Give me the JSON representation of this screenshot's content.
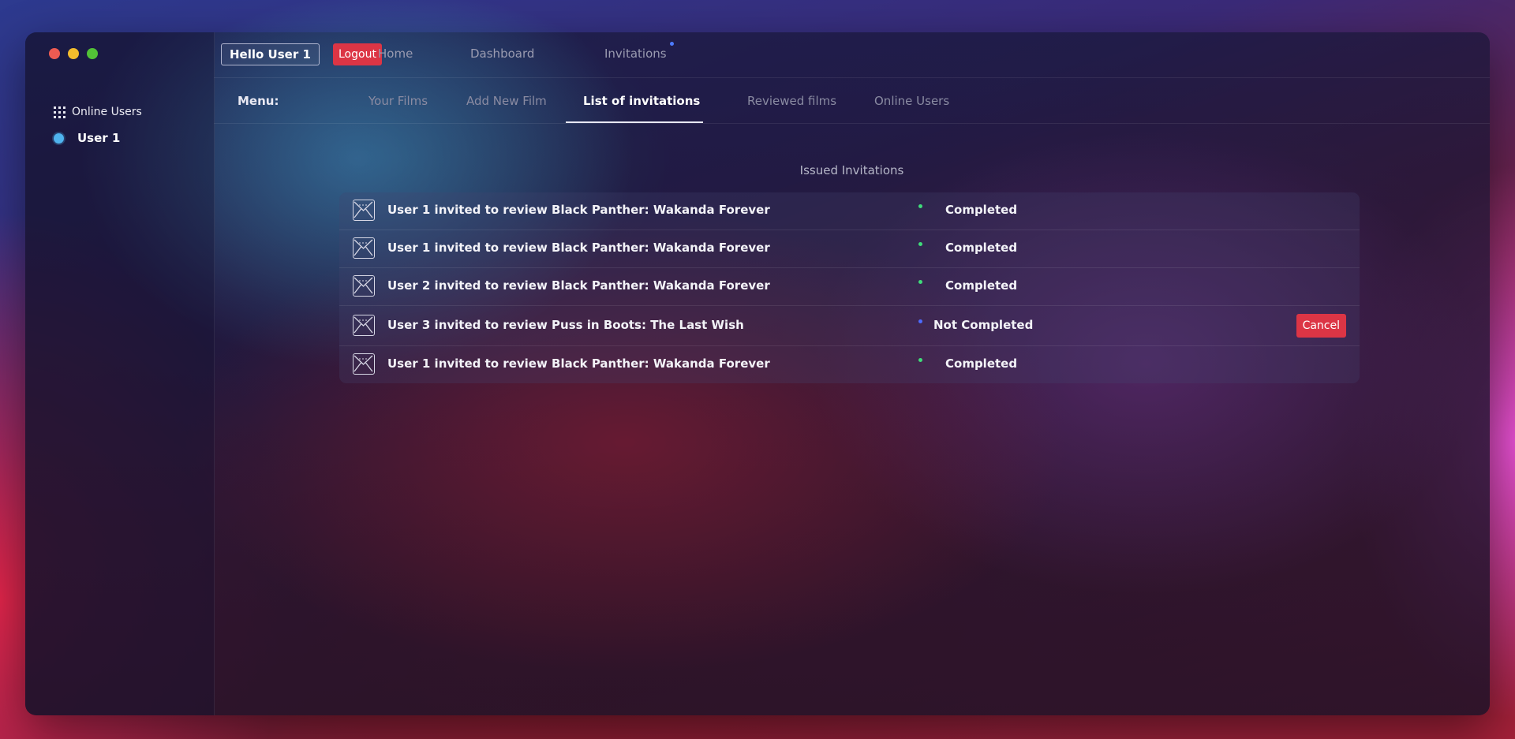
{
  "header": {
    "hello_label": "Hello User 1",
    "logout_label": "Logout",
    "nav": [
      {
        "label": "Home"
      },
      {
        "label": "Dashboard"
      },
      {
        "label": "Invitations"
      }
    ]
  },
  "sidebar": {
    "heading": "Online Users",
    "users": [
      {
        "name": "User 1"
      }
    ]
  },
  "menu": {
    "label": "Menu:",
    "tabs": [
      {
        "label": "Your Films"
      },
      {
        "label": "Add New Film"
      },
      {
        "label": "List of invitations",
        "active": true
      },
      {
        "label": "Reviewed films"
      },
      {
        "label": "Online Users"
      }
    ]
  },
  "main": {
    "section_title": "Issued Invitations",
    "invitations": [
      {
        "text": "User 1 invited to review Black Panther: Wakanda Forever",
        "status": "Completed"
      },
      {
        "text": "User 1 invited to review Black Panther: Wakanda Forever",
        "status": "Completed"
      },
      {
        "text": "User 2 invited to review Black Panther: Wakanda Forever",
        "status": "Completed"
      },
      {
        "text": "User 3 invited to review Puss in Boots: The Last Wish",
        "status": "Not Completed",
        "action": "Cancel"
      },
      {
        "text": "User 1 invited to review Black Panther: Wakanda Forever",
        "status": "Completed"
      }
    ]
  },
  "colors": {
    "completed_dot": "#3fdc7a",
    "pending_dot": "#4d6bff",
    "danger": "#dc3545",
    "online_dot": "#4fb3ee"
  },
  "icons": {
    "invitation": "envelope-icon",
    "online_users": "grid-icon"
  }
}
